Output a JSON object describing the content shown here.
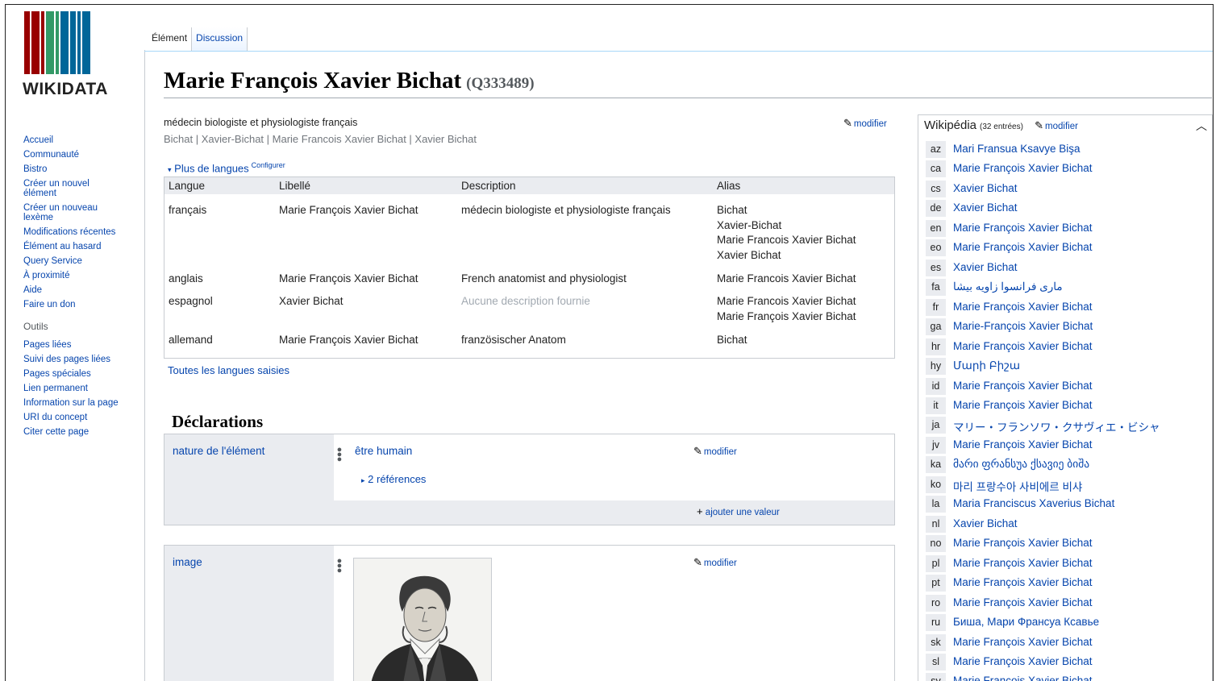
{
  "logo": {
    "text": "WIKIDATA",
    "bar_colors": [
      "#990000",
      "#990000",
      "#990000",
      "#339966",
      "#339966",
      "#006699",
      "#006699",
      "#006699",
      "#006699"
    ]
  },
  "sidebar": {
    "nav": [
      "Accueil",
      "Communauté",
      "Bistro",
      "Créer un nouvel élément",
      "Créer un nouveau lexème",
      "Modifications récentes",
      "Élément au hasard",
      "Query Service",
      "À proximité",
      "Aide",
      "Faire un don"
    ],
    "tools_heading": "Outils",
    "tools": [
      "Pages liées",
      "Suivi des pages liées",
      "Pages spéciales",
      "Lien permanent",
      "Information sur la page",
      "URI du concept",
      "Citer cette page"
    ]
  },
  "tabs": {
    "item": "Élément",
    "discussion": "Discussion"
  },
  "entity": {
    "label": "Marie François Xavier Bichat",
    "id": "(Q333489)",
    "description": "médecin biologiste et physiologiste français",
    "aliases": "Bichat | Xavier-Bichat | Marie Francois Xavier Bichat | Xavier Bichat",
    "edit_label": "modifier"
  },
  "languages": {
    "more_label": "Plus de langues",
    "configure_label": "Configurer",
    "headers": {
      "language": "Langue",
      "label": "Libellé",
      "description": "Description",
      "alias": "Alias"
    },
    "rows": [
      {
        "language": "français",
        "label": "Marie François Xavier Bichat",
        "description": "médecin biologiste et physiologiste français",
        "aliases": [
          "Bichat",
          "Xavier-Bichat",
          "Marie Francois Xavier Bichat",
          "Xavier Bichat"
        ]
      },
      {
        "language": "anglais",
        "label": "Marie François Xavier Bichat",
        "description": "French anatomist and physiologist",
        "aliases": [
          "Marie Francois Xavier Bichat"
        ]
      },
      {
        "language": "espagnol",
        "label": "Xavier Bichat",
        "description": "Aucune description fournie",
        "aliases": [
          "Marie Francois Xavier Bichat",
          "Marie François Xavier Bichat"
        ]
      },
      {
        "language": "allemand",
        "label": "Marie François Xavier Bichat",
        "description": "französischer Anatom",
        "aliases": [
          "Bichat"
        ]
      }
    ],
    "all_languages_label": "Toutes les langues saisies"
  },
  "statements": {
    "heading": "Déclarations",
    "items": [
      {
        "property": "nature de l'élément",
        "value": "être humain",
        "references": "2 références",
        "edit_label": "modifier",
        "add_label": "ajouter une valeur"
      },
      {
        "property": "image",
        "edit_label": "modifier"
      }
    ]
  },
  "wikipedia": {
    "title": "Wikipédia",
    "count": "(32 entrées)",
    "edit_label": "modifier",
    "links": [
      {
        "code": "az",
        "title": "Mari Fransua Ksavye Bişa"
      },
      {
        "code": "ca",
        "title": "Marie François Xavier Bichat"
      },
      {
        "code": "cs",
        "title": "Xavier Bichat"
      },
      {
        "code": "de",
        "title": "Xavier Bichat"
      },
      {
        "code": "en",
        "title": "Marie François Xavier Bichat"
      },
      {
        "code": "eo",
        "title": "Marie François Xavier Bichat"
      },
      {
        "code": "es",
        "title": "Xavier Bichat"
      },
      {
        "code": "fa",
        "title": "ماری فرانسوا زاویه بیشا"
      },
      {
        "code": "fr",
        "title": "Marie François Xavier Bichat"
      },
      {
        "code": "ga",
        "title": "Marie-François Xavier Bichat"
      },
      {
        "code": "hr",
        "title": "Marie François Xavier Bichat"
      },
      {
        "code": "hy",
        "title": "Մարի Բիշա"
      },
      {
        "code": "id",
        "title": "Marie François Xavier Bichat"
      },
      {
        "code": "it",
        "title": "Marie François Xavier Bichat"
      },
      {
        "code": "ja",
        "title": "マリー・フランソワ・クサヴィエ・ビシャ"
      },
      {
        "code": "jv",
        "title": "Marie François Xavier Bichat"
      },
      {
        "code": "ka",
        "title": "მარი ფრანსუა ქსავიე ბიშა"
      },
      {
        "code": "ko",
        "title": "마리 프랑수아 사비에르 비샤"
      },
      {
        "code": "la",
        "title": "Maria Franciscus Xaverius Bichat"
      },
      {
        "code": "nl",
        "title": "Xavier Bichat"
      },
      {
        "code": "no",
        "title": "Marie François Xavier Bichat"
      },
      {
        "code": "pl",
        "title": "Marie François Xavier Bichat"
      },
      {
        "code": "pt",
        "title": "Marie François Xavier Bichat"
      },
      {
        "code": "ro",
        "title": "Marie François Xavier Bichat"
      },
      {
        "code": "ru",
        "title": "Биша, Мари Франсуа Ксавье"
      },
      {
        "code": "sk",
        "title": "Marie François Xavier Bichat"
      },
      {
        "code": "sl",
        "title": "Marie François Xavier Bichat"
      },
      {
        "code": "sv",
        "title": "Marie François Xavier Bichat"
      }
    ]
  }
}
